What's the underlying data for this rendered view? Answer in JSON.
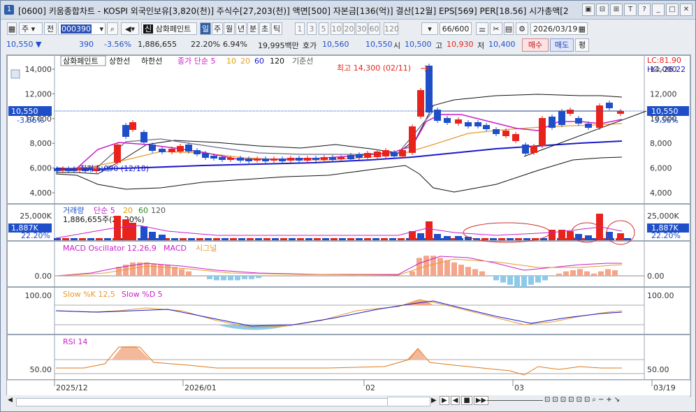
{
  "window": {
    "title_badge": "1",
    "title": "[0600] 키움종합차트 - KOSPI 외국인보유[3,820(천)] 주식수[27,203(천)] 액면[500] 자본금[136(억)] 결산[12월] EPS[569] PER[18.56] 시가총액[2",
    "title_buttons": [
      "▣",
      "⊟",
      "⊞",
      "T",
      "?",
      "_",
      "□",
      "✕"
    ]
  },
  "toolbar": {
    "market_tab": "주",
    "period_tab": "전",
    "code": "000390",
    "stock_name": "삼화페인트",
    "period_buttons": [
      "일",
      "주",
      "월",
      "년",
      "분",
      "초",
      "틱"
    ],
    "interval_buttons": [
      "1",
      "3",
      "5",
      "10",
      "20",
      "30",
      "60",
      "120"
    ],
    "count": "66",
    "count_max": "/600",
    "date": "2026/03/19"
  },
  "quote": {
    "price": "10,550",
    "change": "390",
    "change_pct": "-3.56%",
    "volume": "1,886,655",
    "vol_ratio": "22.20%",
    "turnover": "6.94%",
    "amount": "19,995백만",
    "hoga_label": "호가",
    "hoga1": "10,560",
    "hoga2": "10,550",
    "open_label": "시",
    "open": "10,500",
    "high_label": "고",
    "high": "10,930",
    "low_label": "저",
    "low": "10,400",
    "buy_button": "매수",
    "sell_button": "매도",
    "eval_button": "평"
  },
  "price_pane": {
    "legend_stock": "삼화페인트",
    "legend_upper": "상한선",
    "legend_lower": "하한선",
    "legend_ma": "종가 단순 5",
    "legend_ma10": "10",
    "legend_ma20": "20",
    "legend_ma60": "60",
    "legend_ma120": "120",
    "legend_base": "기준선",
    "high_note": "최고 14,300 (02/11)",
    "low_note": "최저 5,090 (12/18)",
    "lc": "LC:81.90",
    "hc": "HC:-26.22",
    "yaxis": [
      "14,000",
      "12,000",
      "10,000",
      "8,000",
      "6,000",
      "4,000"
    ],
    "current": "10,550",
    "current_pct": "-3.56%"
  },
  "volume_pane": {
    "legend": "거래량",
    "legend_ma": "단순 5",
    "legend_20": "20",
    "legend_60": "60",
    "legend_120": "120",
    "sub": "1,886,655주(22.20%)",
    "yaxis_top": "25,000K",
    "current": "1,887K",
    "current_pct": "22.20%"
  },
  "macd_pane": {
    "legend_osc": "MACD Oscillator 12,26,9",
    "legend_macd": "MACD",
    "legend_signal": "시그널",
    "zero": "0.00"
  },
  "stoch_pane": {
    "legend_k": "Slow %K 12,5",
    "legend_d": "Slow %D 5",
    "top": "100.00"
  },
  "rsi_pane": {
    "legend": "RSI 14",
    "mid": "50.00"
  },
  "x_axis": [
    "2025/12",
    "2026/01",
    "02",
    "03",
    "03/19"
  ],
  "colors": {
    "up": "#e8231c",
    "down": "#1f4fc8",
    "ma5": "#c81ec8",
    "ma10": "#f0a020",
    "ma20": "#e89a2a",
    "ma60": "#1a1acc",
    "bb": "#111111",
    "base": "#6a6a8a"
  }
}
